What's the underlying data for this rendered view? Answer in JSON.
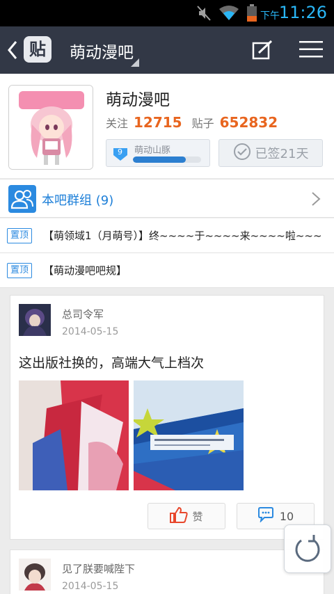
{
  "status_bar": {
    "ampm": "下午",
    "time": "11:26",
    "icons": [
      "mute-icon",
      "wifi-icon",
      "battery-low-icon"
    ]
  },
  "nav": {
    "logo_text": "贴",
    "title": "萌动漫吧",
    "icons": [
      "back-chevron-icon",
      "edit-icon",
      "menu-icon"
    ]
  },
  "forum": {
    "name": "萌动漫吧",
    "follow_label": "关注",
    "follow_count": "12715",
    "posts_label": "贴子",
    "posts_count": "652832",
    "level_number": "9",
    "level_name": "萌动山豚",
    "level_progress": 0.78,
    "signed_label": "已签21天"
  },
  "group": {
    "label": "本吧群组 (9)"
  },
  "pinned": [
    {
      "badge": "置顶",
      "text": "【萌领域1（月萌号）】终~~~~于~~~~来~~~~啦~~~"
    },
    {
      "badge": "置顶",
      "text": "【萌动漫吧吧规】"
    }
  ],
  "posts": [
    {
      "author": "总司令军",
      "date": "2014-05-15",
      "title": "这出版社换的，高端大气上档次",
      "like_label": "赞",
      "comment_count": "10"
    },
    {
      "author": "见了朕要喊陛下",
      "date": "2014-05-15"
    }
  ],
  "colors": {
    "accent": "#2b8ae0",
    "count": "#e8651f",
    "nav_bg": "#323846",
    "like": "#e8472c"
  }
}
